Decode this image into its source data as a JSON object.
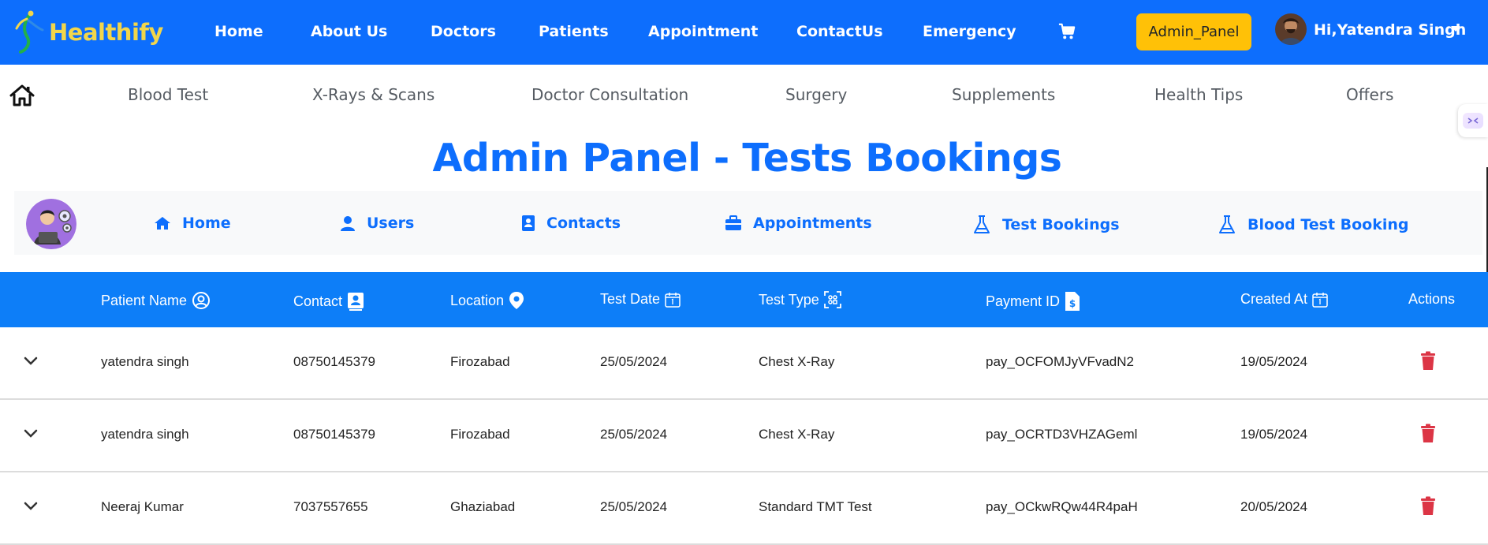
{
  "navbar": {
    "brand": "Healthify",
    "links": [
      "Home",
      "About Us",
      "Doctors",
      "Patients",
      "Appointment",
      "ContactUs",
      "Emergency"
    ],
    "cart_icon": "cart-icon",
    "admin_button": "Admin_Panel",
    "user_greeting": "Hi,Yatendra Singh"
  },
  "subnav": {
    "home_icon": "home-icon",
    "links": [
      "Blood Test",
      "X-Rays & Scans",
      "Doctor Consultation",
      "Surgery",
      "Supplements",
      "Health Tips",
      "Offers"
    ]
  },
  "page_title": "Admin Panel - Tests Bookings",
  "admin_nav": {
    "links": [
      "Home",
      "Users",
      "Contacts",
      "Appointments",
      "Test Bookings",
      "Blood Test Booking"
    ]
  },
  "table": {
    "columns": [
      "Patient Name",
      "Contact",
      "Location",
      "Test Date",
      "Test Type",
      "Payment ID",
      "Created At",
      "Actions"
    ],
    "rows": [
      {
        "patient": "yatendra singh",
        "contact": "08750145379",
        "location": "Firozabad",
        "test_date": "25/05/2024",
        "test_type": "Chest X-Ray",
        "payment_id": "pay_OCFOMJyVFvadN2",
        "created_at": "19/05/2024"
      },
      {
        "patient": "yatendra singh",
        "contact": "08750145379",
        "location": "Firozabad",
        "test_date": "25/05/2024",
        "test_type": "Chest X-Ray",
        "payment_id": "pay_OCRTD3VHZAGeml",
        "created_at": "19/05/2024"
      },
      {
        "patient": "Neeraj Kumar",
        "contact": "7037557655",
        "location": "Ghaziabad",
        "test_date": "25/05/2024",
        "test_type": "Standard TMT Test",
        "payment_id": "pay_OCkwRQw44R4paH",
        "created_at": "20/05/2024"
      }
    ]
  },
  "colors": {
    "primary": "#0d6efd",
    "table_header": "#0d7ef8",
    "admin_button": "#ffc107",
    "brand_text": "#f2d64b",
    "delete": "#dc3545"
  }
}
